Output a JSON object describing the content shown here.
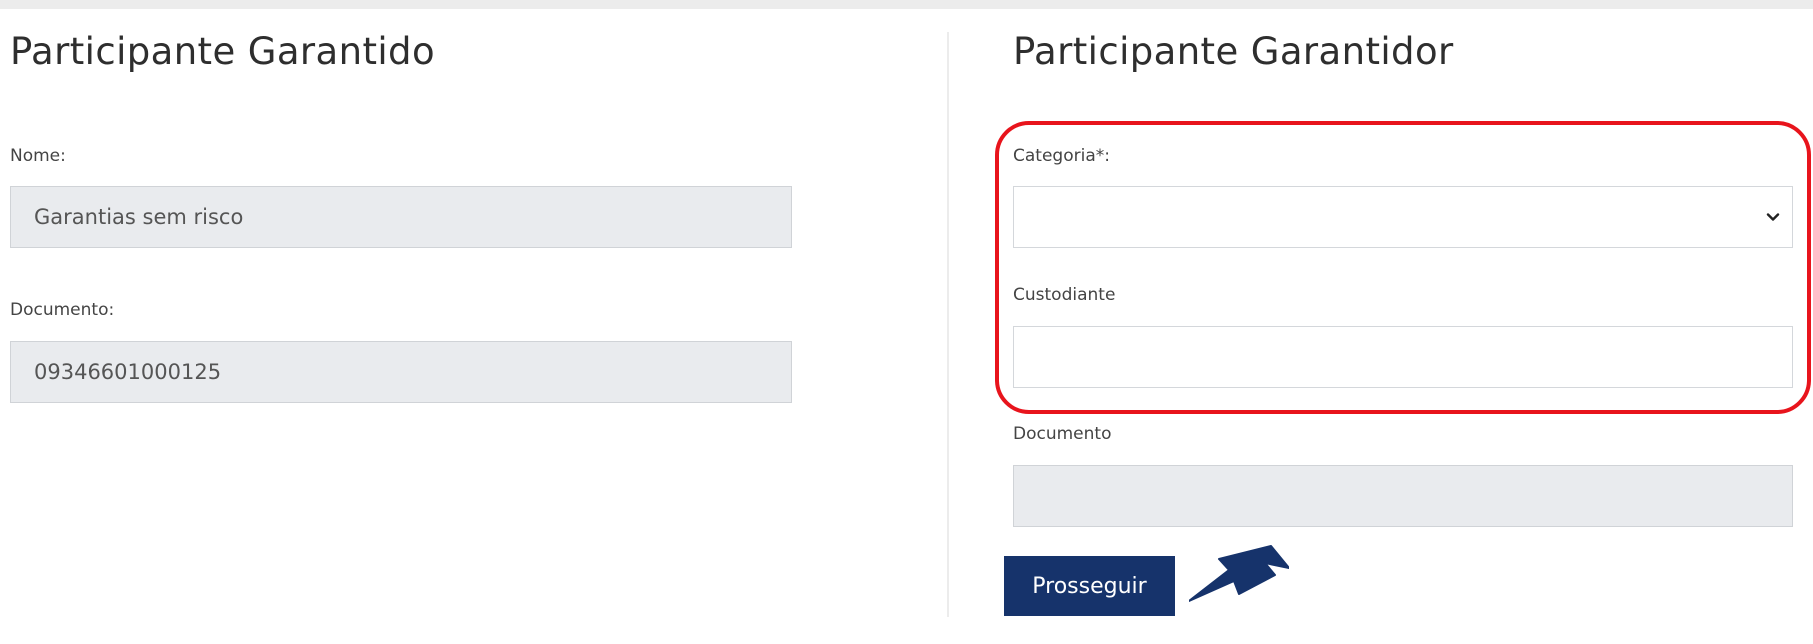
{
  "garantido": {
    "title": "Participante Garantido",
    "nome_label": "Nome:",
    "nome_value": "Garantias sem risco",
    "documento_label": "Documento:",
    "documento_value": "09346601000125"
  },
  "garantidor": {
    "title": "Participante Garantidor",
    "categoria_label": "Categoria*:",
    "categoria_value": "",
    "custodiante_label": "Custodiante",
    "custodiante_value": "",
    "documento_label": "Documento",
    "documento_value": ""
  },
  "actions": {
    "proceed_label": "Prosseguir"
  },
  "annotations": {
    "highlight_color": "#e8141c",
    "arrow_color": "#16336b",
    "arrow_icon": "arrow-pointing-left-down"
  },
  "colors": {
    "button_bg": "#16336b",
    "readonly_field_bg": "#e9ebee"
  }
}
